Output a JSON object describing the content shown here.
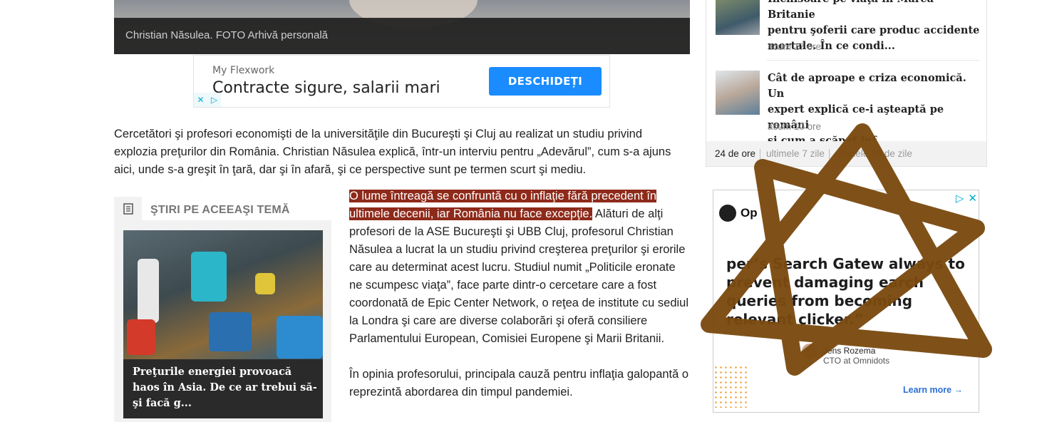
{
  "hero": {
    "caption": "Christian Năsulea. FOTO Arhivă personală"
  },
  "ad_banner": {
    "advertiser": "My Flexwork",
    "headline": "Contracte sigure, salarii mari",
    "cta": "DESCHIDEȚI"
  },
  "article": {
    "intro": "Cercetători şi profesori economişti de la universităţile din Bucureşti şi Cluj au realizat un studiu privind explozia preţurilor din România. Christian Năsulea explică, într-un interviu pentru „Adevărul”, cum s-a ajuns aici, unde s-a greşit în ţară, dar şi în afară, şi ce perspective sunt pe termen scurt şi mediu.",
    "highlight": "O lume întreagă se confruntă cu o inflaţie fără precedent în ultimele decenii, iar România nu face excepţie.",
    "para1_rest": " Alături de alţi profesori de la ASE Bucureşti şi UBB Cluj, profesorul Christian Năsulea a lucrat la un studiu privind creşterea preţurilor şi erorile care au determinat acest lucru. Studiul numit „Politicile eronate ne scumpesc viaţa”, face parte dintr-o cercetare care a fost coordonată de Epic Center Network, o reţea de institute cu sediul la Londra şi care are diverse colaborări şi oferă consiliere Parlamentului European, Comisiei Europene şi Marii Britanii.",
    "para2": "În opinia profesorului, principala cauză pentru inflaţia galopantă o reprezintă abordarea din timpul pandemiei."
  },
  "related": {
    "heading": "ŞTIRI PE ACEEAŞI TEMĂ",
    "card_title": "Preţurile energiei provoacă haos în Asia. De ce ar trebui să-şi facă g..."
  },
  "sidebar": {
    "items": [
      {
        "title_lines": [
          "Închisoare pe viaţă în Marea Britanie",
          "pentru şoferii care produc accidente",
          "mortale. În ce condi..."
        ],
        "time": "acum 17 ore"
      },
      {
        "title_lines": [
          "Cât de aproape e criza economică. Un",
          "expert explică ce-i aşteaptă pe români",
          "şi cum a scăpat inf..."
        ],
        "time": "acum 10 ore"
      }
    ],
    "tabs": [
      "24 de ore",
      "ultimele 7 zile",
      "ultimele 30 de zile"
    ]
  },
  "side_ad": {
    "brand": "Op",
    "quote": "per’s Search Gatew always to prevent damaging earch queries from becoming relevant clicker.”",
    "person_name": "Jens Rozema",
    "person_role": "CTO at Omnidots",
    "learn_more": "Learn more →"
  },
  "overlay": {
    "color": "#7a4a10"
  }
}
